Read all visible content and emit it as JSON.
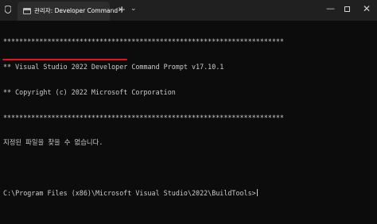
{
  "window": {
    "tab_title": "관리자: Developer Command",
    "tab_close_glyph": "✕",
    "new_tab_glyph": "+",
    "dropdown_glyph": "⌄",
    "minimize_glyph": "—",
    "close_glyph": "✕"
  },
  "console": {
    "lines": [
      "**********************************************************************",
      "** Visual Studio 2022 Developer Command Prompt v17.10.1",
      "** Copyright (c) 2022 Microsoft Corporation",
      "**********************************************************************",
      "지정된 파일을 찾을 수 없습니다.",
      "",
      "C:\\Program Files (x86)\\Microsoft Visual Studio\\2022\\BuildTools>"
    ]
  },
  "colors": {
    "background": "#0c0c0c",
    "titlebar": "#202020",
    "tab": "#2d2d2d",
    "text": "#cccccc",
    "error_underline": "#e81123"
  },
  "icons": {
    "shield": "shield-icon",
    "terminal": "terminal-icon"
  }
}
